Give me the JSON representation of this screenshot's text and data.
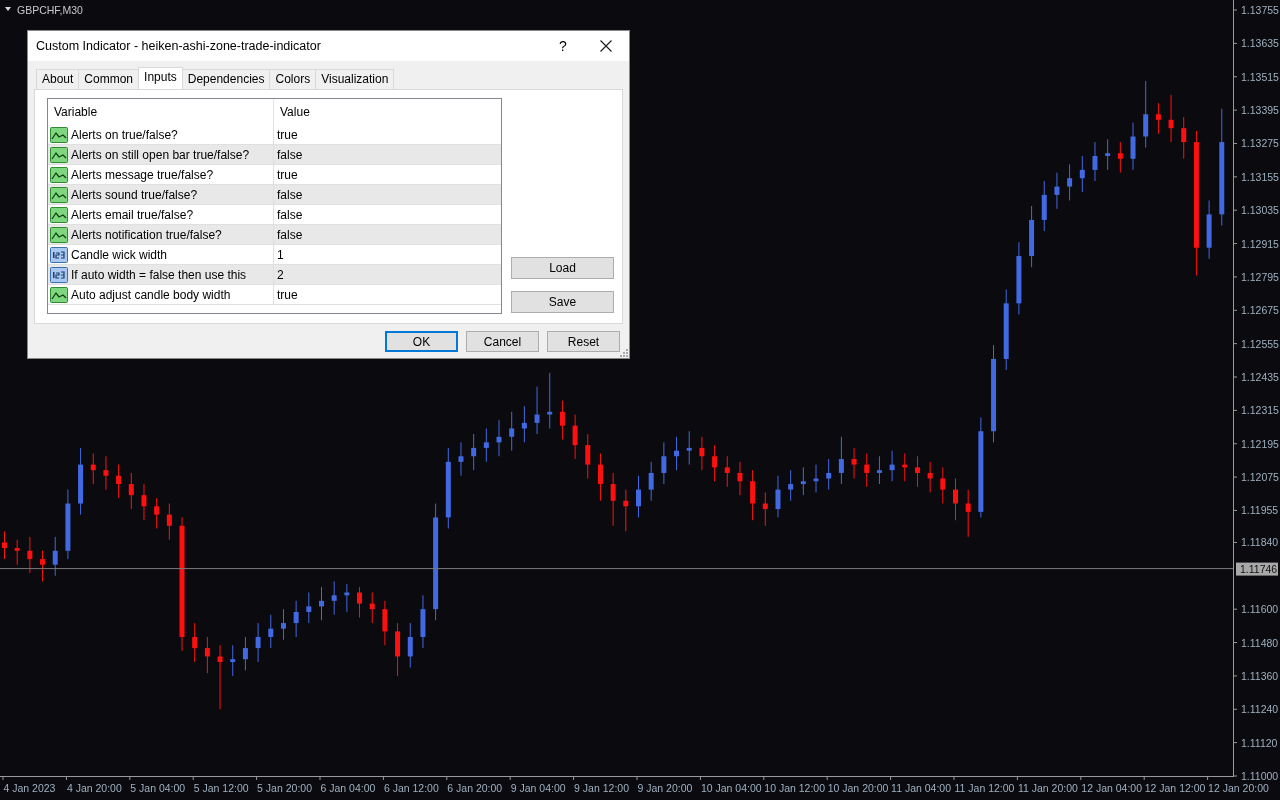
{
  "chart": {
    "symbol": "GBPCHF,M30",
    "current_price": "1.11746",
    "time_labels": [
      "4 Jan 2023",
      "4 Jan 20:00",
      "5 Jan 04:00",
      "5 Jan 12:00",
      "5 Jan 20:00",
      "6 Jan 04:00",
      "6 Jan 12:00",
      "6 Jan 20:00",
      "9 Jan 04:00",
      "9 Jan 12:00",
      "9 Jan 20:00",
      "10 Jan 04:00",
      "10 Jan 12:00",
      "10 Jan 20:00",
      "11 Jan 04:00",
      "11 Jan 12:00",
      "11 Jan 20:00",
      "12 Jan 04:00",
      "12 Jan 12:00",
      "12 Jan 20:00"
    ],
    "chart_data": {
      "type": "candlestick",
      "ylim": [
        1.11,
        1.13791
      ],
      "yticks": [
        1.13755,
        1.13635,
        1.13515,
        1.13395,
        1.13275,
        1.13155,
        1.13035,
        1.12915,
        1.12795,
        1.12675,
        1.12555,
        1.12435,
        1.12315,
        1.12195,
        1.12075,
        1.11955,
        {
          "value": 1.1184,
          "label": "1.11840"
        },
        {
          "value": 1.116,
          "label": "1.11600"
        },
        {
          "value": 1.1148,
          "label": "1.11480"
        },
        {
          "value": 1.1136,
          "label": "1.11360"
        },
        {
          "value": 1.1124,
          "label": "1.11240"
        },
        {
          "value": 1.1112,
          "label": "1.11120"
        },
        {
          "value": 1.11,
          "label": "1.11000"
        }
      ],
      "ohlc": [
        [
          1.1184,
          1.1188,
          1.1178,
          1.1182
        ],
        [
          1.1182,
          1.1185,
          1.1176,
          1.1181
        ],
        [
          1.1181,
          1.1186,
          1.1173,
          1.1178
        ],
        [
          1.1178,
          1.1181,
          1.117,
          1.1176
        ],
        [
          1.1176,
          1.1186,
          1.1172,
          1.1181
        ],
        [
          1.1181,
          1.1203,
          1.1178,
          1.1198
        ],
        [
          1.1198,
          1.1218,
          1.1194,
          1.1212
        ],
        [
          1.1212,
          1.1216,
          1.1205,
          1.121
        ],
        [
          1.121,
          1.1215,
          1.1203,
          1.1208
        ],
        [
          1.1208,
          1.1212,
          1.12,
          1.1205
        ],
        [
          1.1205,
          1.1209,
          1.1196,
          1.1201
        ],
        [
          1.1201,
          1.1205,
          1.1192,
          1.1197
        ],
        [
          1.1197,
          1.12,
          1.1189,
          1.1194
        ],
        [
          1.1194,
          1.1198,
          1.1185,
          1.119
        ],
        [
          1.119,
          1.1193,
          1.1145,
          1.115
        ],
        [
          1.115,
          1.1155,
          1.1141,
          1.1146
        ],
        [
          1.1146,
          1.115,
          1.1137,
          1.1143
        ],
        [
          1.1143,
          1.1147,
          1.1124,
          1.1141
        ],
        [
          1.1141,
          1.1147,
          1.1136,
          1.1142
        ],
        [
          1.1142,
          1.115,
          1.1138,
          1.1146
        ],
        [
          1.1146,
          1.1155,
          1.1141,
          1.115
        ],
        [
          1.115,
          1.1158,
          1.1146,
          1.1153
        ],
        [
          1.1153,
          1.116,
          1.1149,
          1.1155
        ],
        [
          1.1155,
          1.1163,
          1.115,
          1.1159
        ],
        [
          1.1159,
          1.1166,
          1.1155,
          1.1161
        ],
        [
          1.1161,
          1.1168,
          1.1156,
          1.1163
        ],
        [
          1.1163,
          1.117,
          1.1158,
          1.1165
        ],
        [
          1.1165,
          1.1169,
          1.1159,
          1.1166
        ],
        [
          1.1166,
          1.1168,
          1.1157,
          1.1162
        ],
        [
          1.1162,
          1.1166,
          1.1155,
          1.116
        ],
        [
          1.116,
          1.1163,
          1.1147,
          1.1152
        ],
        [
          1.1152,
          1.1155,
          1.1136,
          1.1143
        ],
        [
          1.1143,
          1.1155,
          1.1139,
          1.115
        ],
        [
          1.115,
          1.1165,
          1.1146,
          1.116
        ],
        [
          1.116,
          1.1198,
          1.1156,
          1.1193
        ],
        [
          1.1193,
          1.1218,
          1.1189,
          1.1213
        ],
        [
          1.1213,
          1.122,
          1.1208,
          1.1215
        ],
        [
          1.1215,
          1.1223,
          1.121,
          1.1218
        ],
        [
          1.1218,
          1.1225,
          1.1213,
          1.122
        ],
        [
          1.122,
          1.1228,
          1.1215,
          1.1222
        ],
        [
          1.1222,
          1.1231,
          1.1217,
          1.1225
        ],
        [
          1.1225,
          1.1233,
          1.122,
          1.1227
        ],
        [
          1.1227,
          1.124,
          1.1223,
          1.123
        ],
        [
          1.123,
          1.1245,
          1.1225,
          1.1231
        ],
        [
          1.1231,
          1.1235,
          1.1221,
          1.1226
        ],
        [
          1.1226,
          1.123,
          1.1214,
          1.1219
        ],
        [
          1.1219,
          1.1223,
          1.1207,
          1.1212
        ],
        [
          1.1212,
          1.1216,
          1.1199,
          1.1205
        ],
        [
          1.1205,
          1.1209,
          1.119,
          1.1199
        ],
        [
          1.1199,
          1.1203,
          1.1188,
          1.1197
        ],
        [
          1.1197,
          1.1208,
          1.1193,
          1.1203
        ],
        [
          1.1203,
          1.1213,
          1.1199,
          1.1209
        ],
        [
          1.1209,
          1.122,
          1.1205,
          1.1215
        ],
        [
          1.1215,
          1.1222,
          1.121,
          1.1217
        ],
        [
          1.1217,
          1.1224,
          1.1212,
          1.1218
        ],
        [
          1.1218,
          1.1222,
          1.121,
          1.1215
        ],
        [
          1.1215,
          1.1219,
          1.1206,
          1.1211
        ],
        [
          1.1211,
          1.1215,
          1.1204,
          1.1209
        ],
        [
          1.1209,
          1.1213,
          1.1201,
          1.1206
        ],
        [
          1.1206,
          1.121,
          1.1192,
          1.1198
        ],
        [
          1.1198,
          1.1202,
          1.119,
          1.1196
        ],
        [
          1.1196,
          1.1208,
          1.1193,
          1.1203
        ],
        [
          1.1203,
          1.121,
          1.1199,
          1.1205
        ],
        [
          1.1205,
          1.1211,
          1.1201,
          1.1206
        ],
        [
          1.1206,
          1.1212,
          1.1202,
          1.1207
        ],
        [
          1.1207,
          1.1214,
          1.1203,
          1.1209
        ],
        [
          1.1209,
          1.1222,
          1.1205,
          1.1214
        ],
        [
          1.1214,
          1.1218,
          1.1207,
          1.1212
        ],
        [
          1.1212,
          1.1216,
          1.1204,
          1.1209
        ],
        [
          1.1209,
          1.1215,
          1.1205,
          1.121
        ],
        [
          1.121,
          1.1217,
          1.1206,
          1.1212
        ],
        [
          1.1212,
          1.1216,
          1.1206,
          1.1211
        ],
        [
          1.1211,
          1.1215,
          1.1204,
          1.1209
        ],
        [
          1.1209,
          1.1213,
          1.1202,
          1.1207
        ],
        [
          1.1207,
          1.1211,
          1.1198,
          1.1203
        ],
        [
          1.1203,
          1.1207,
          1.1192,
          1.1198
        ],
        [
          1.1198,
          1.1203,
          1.1186,
          1.1195
        ],
        [
          1.1195,
          1.1229,
          1.1193,
          1.1224
        ],
        [
          1.1224,
          1.1255,
          1.122,
          1.125
        ],
        [
          1.125,
          1.1275,
          1.1246,
          1.127
        ],
        [
          1.127,
          1.1292,
          1.1266,
          1.1287
        ],
        [
          1.1287,
          1.1305,
          1.1283,
          1.13
        ],
        [
          1.13,
          1.1314,
          1.1296,
          1.1309
        ],
        [
          1.1309,
          1.1317,
          1.1304,
          1.1312
        ],
        [
          1.1312,
          1.132,
          1.1307,
          1.1315
        ],
        [
          1.1315,
          1.1323,
          1.131,
          1.1318
        ],
        [
          1.1318,
          1.1328,
          1.1314,
          1.1323
        ],
        [
          1.1323,
          1.1329,
          1.1318,
          1.1324
        ],
        [
          1.1324,
          1.1328,
          1.1317,
          1.1322
        ],
        [
          1.1322,
          1.1335,
          1.1318,
          1.133
        ],
        [
          1.133,
          1.135,
          1.1326,
          1.1338
        ],
        [
          1.1338,
          1.1342,
          1.1331,
          1.1336
        ],
        [
          1.1336,
          1.1345,
          1.1328,
          1.1333
        ],
        [
          1.1333,
          1.1337,
          1.1322,
          1.1328
        ],
        [
          1.1328,
          1.1332,
          1.128,
          1.129
        ],
        [
          1.129,
          1.1307,
          1.1286,
          1.1302
        ],
        [
          1.1302,
          1.134,
          1.1298,
          1.1328
        ]
      ]
    }
  },
  "dialog": {
    "title": "Custom Indicator - heiken-ashi-zone-trade-indicator",
    "help": "?",
    "tabs": [
      {
        "label": "About",
        "selected": false
      },
      {
        "label": "Common",
        "selected": false
      },
      {
        "label": "Inputs",
        "selected": true
      },
      {
        "label": "Dependencies",
        "selected": false
      },
      {
        "label": "Colors",
        "selected": false
      },
      {
        "label": "Visualization",
        "selected": false
      }
    ],
    "columns": [
      "Variable",
      "Value"
    ],
    "rows": [
      {
        "kind": "bool",
        "variable": "Alerts on true/false?",
        "value": "true"
      },
      {
        "kind": "bool",
        "variable": "Alerts on still open bar true/false?",
        "value": "false"
      },
      {
        "kind": "bool",
        "variable": "Alerts message true/false?",
        "value": "true"
      },
      {
        "kind": "bool",
        "variable": "Alerts sound true/false?",
        "value": "false"
      },
      {
        "kind": "bool",
        "variable": "Alerts email true/false?",
        "value": "false"
      },
      {
        "kind": "bool",
        "variable": "Alerts notification true/false?",
        "value": "false"
      },
      {
        "kind": "int",
        "variable": "Candle wick width",
        "value": "1"
      },
      {
        "kind": "int",
        "variable": "If auto width = false then use this",
        "value": "2"
      },
      {
        "kind": "bool",
        "variable": "Auto adjust candle body width",
        "value": "true"
      }
    ],
    "side_buttons": [
      "Load",
      "Save"
    ],
    "buttons": [
      {
        "label": "OK",
        "default": true
      },
      {
        "label": "Cancel",
        "default": false
      },
      {
        "label": "Reset",
        "default": false
      }
    ]
  }
}
